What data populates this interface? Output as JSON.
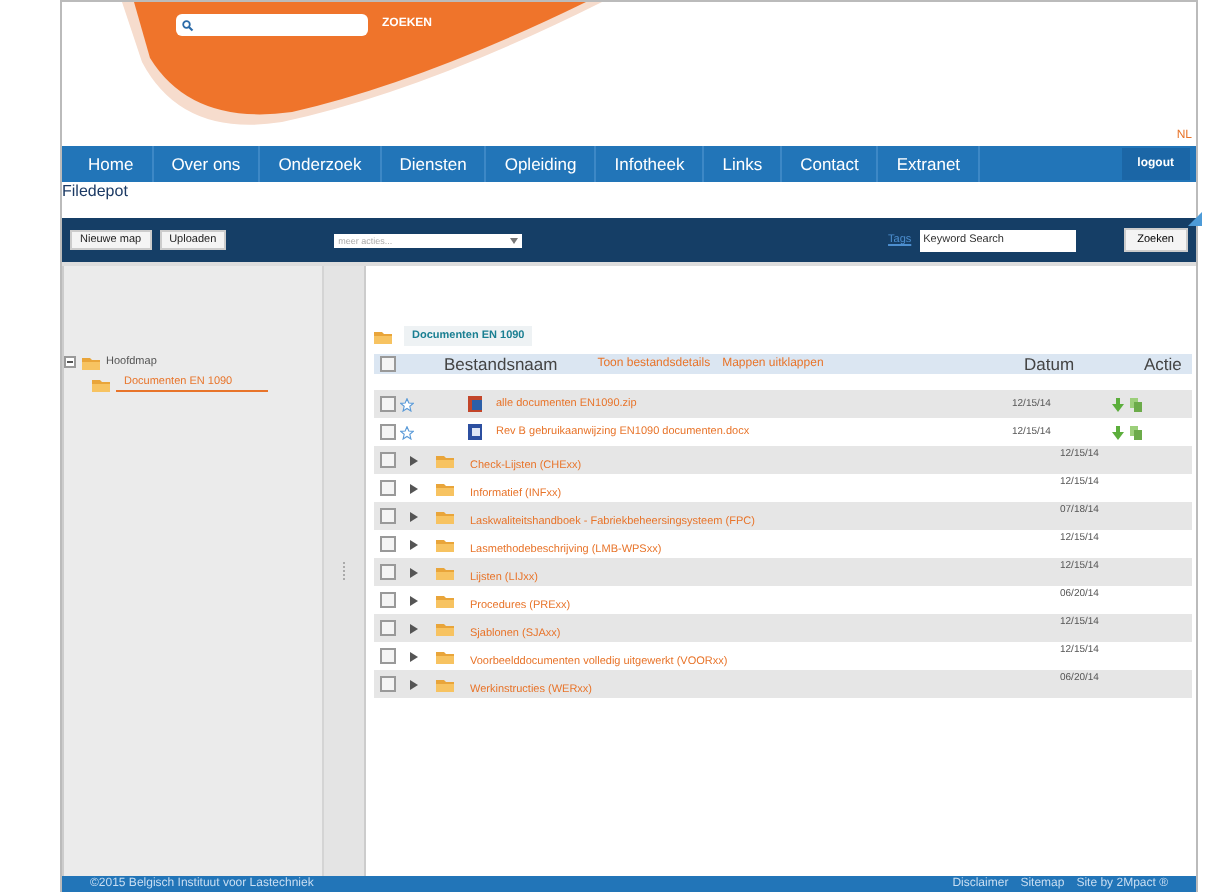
{
  "header": {
    "search_button": "ZOEKEN",
    "language": "NL"
  },
  "nav": {
    "items": [
      {
        "label": "Home"
      },
      {
        "label": "Over ons"
      },
      {
        "label": "Onderzoek"
      },
      {
        "label": "Diensten"
      },
      {
        "label": "Opleiding"
      },
      {
        "label": "Infotheek"
      },
      {
        "label": "Links"
      },
      {
        "label": "Contact"
      },
      {
        "label": "Extranet"
      }
    ],
    "logout": "logout"
  },
  "page_title": "Filedepot",
  "toolbar": {
    "buttons": [
      "Nieuwe map",
      "Uploaden"
    ],
    "actions_placeholder": "meer acties...",
    "tags_link": "Tags",
    "search_value": "Keyword Search",
    "search_button": "Zoeken"
  },
  "tree": [
    {
      "label": "Hoofdmap",
      "expanded": true,
      "selected": false,
      "children": [
        {
          "label": "Documenten EN 1090",
          "selected": true
        }
      ]
    }
  ],
  "folder_title": "Documenten EN 1090",
  "columns": {
    "select_all_checked": false,
    "name": "Bestandsnaam",
    "details_link": "Toon bestandsdetails",
    "expand_link": "Mappen uitklappen",
    "date": "Datum",
    "actions": "Actie"
  },
  "rows": [
    {
      "kind": "archive",
      "checked": false,
      "name": "alle documenten EN1090.zip",
      "date": "12/15/14"
    },
    {
      "kind": "document",
      "checked": false,
      "name": "Rev B gebruikaanwijzing EN1090 documenten.docx",
      "date": "12/15/14"
    },
    {
      "kind": "folder",
      "checked": false,
      "name": "Check-Lijsten (CHExx)",
      "date": "12/15/14"
    },
    {
      "kind": "folder",
      "checked": false,
      "name": "Informatief (INFxx)",
      "date": "12/15/14"
    },
    {
      "kind": "folder",
      "checked": false,
      "name": "Laskwaliteitshandboek - Fabriekbeheersingsysteem (FPC)",
      "date": "07/18/14"
    },
    {
      "kind": "folder",
      "checked": false,
      "name": "Lasmethodebeschrijving (LMB-WPSxx)",
      "date": "12/15/14"
    },
    {
      "kind": "folder",
      "checked": false,
      "name": "Lijsten (LIJxx)",
      "date": "12/15/14"
    },
    {
      "kind": "folder",
      "checked": false,
      "name": "Procedures (PRExx)",
      "date": "06/20/14"
    },
    {
      "kind": "folder",
      "checked": false,
      "name": "Sjablonen (SJAxx)",
      "date": "12/15/14"
    },
    {
      "kind": "folder",
      "checked": false,
      "name": "Voorbeelddocumenten volledig uitgewerkt (VOORxx)",
      "date": "12/15/14"
    },
    {
      "kind": "folder",
      "checked": false,
      "name": "Werkinstructies (WERxx)",
      "date": "06/20/14"
    }
  ],
  "footer": {
    "copyright": "©2015 Belgisch Instituut voor Lastechniek",
    "links": [
      "Disclaimer",
      "Sitemap",
      "Site by 2Mpact ®"
    ]
  }
}
